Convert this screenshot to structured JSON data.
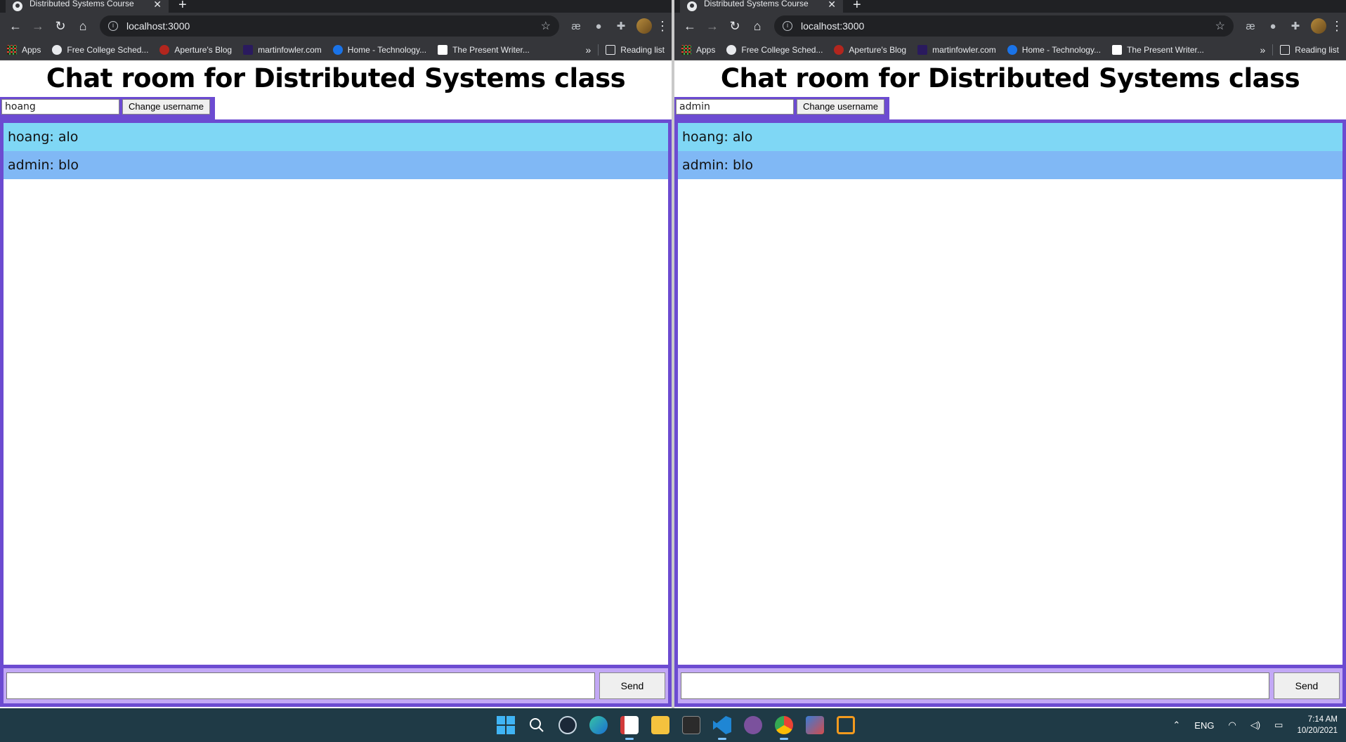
{
  "windows": [
    {
      "tab_title": "Distributed Systems Course",
      "url": "localhost:3000",
      "bookmarks": [
        "Apps",
        "Free College Sched...",
        "Aperture's Blog",
        "martinfowler.com",
        "Home - Technology...",
        "The Present Writer..."
      ],
      "reading_list": "Reading list",
      "heading": "Chat room for Distributed Systems class",
      "username_value": "hoang",
      "change_username_label": "Change username",
      "messages": [
        "hoang: alo",
        "admin: blo"
      ],
      "message_input_value": "",
      "send_label": "Send"
    },
    {
      "tab_title": "Distributed Systems Course",
      "url": "localhost:3000",
      "bookmarks": [
        "Apps",
        "Free College Sched...",
        "Aperture's Blog",
        "martinfowler.com",
        "Home - Technology...",
        "The Present Writer..."
      ],
      "reading_list": "Reading list",
      "heading": "Chat room for Distributed Systems class",
      "username_value": "admin",
      "change_username_label": "Change username",
      "messages": [
        "hoang: alo",
        "admin: blo"
      ],
      "message_input_value": "",
      "send_label": "Send"
    }
  ],
  "colors": {
    "accent_border": "#6c4bd1",
    "compose_bg": "#c2a8f5",
    "msg_1_bg": "#7fd7f5",
    "msg_2_bg": "#80b8f5"
  },
  "taskbar": {
    "apps": [
      "start-icon",
      "search-icon",
      "steam-icon",
      "edge-icon",
      "snipping-tool-icon",
      "file-explorer-icon",
      "terminal-icon",
      "vscode-icon",
      "viber-icon",
      "chrome-icon",
      "photos-icon",
      "vmware-icon"
    ],
    "language": "ENG",
    "time": "7:14 AM",
    "date": "10/20/2021"
  }
}
